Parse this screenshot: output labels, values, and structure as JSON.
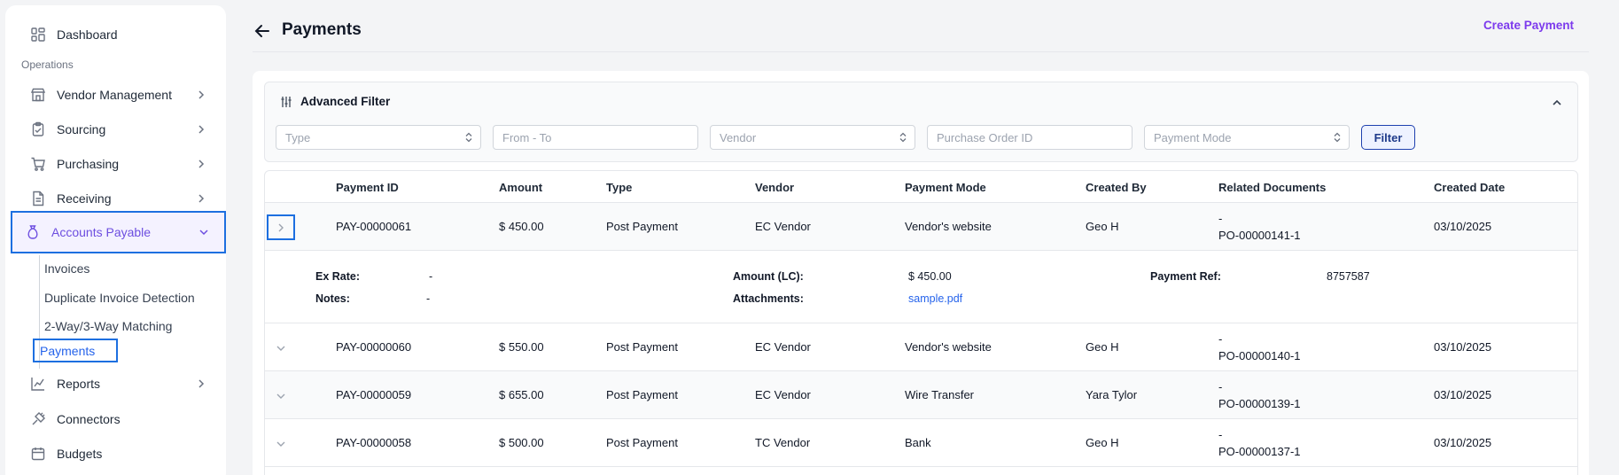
{
  "sidebar": {
    "dashboard": "Dashboard",
    "section_label": "Operations",
    "items": [
      {
        "label": "Vendor Management"
      },
      {
        "label": "Sourcing"
      },
      {
        "label": "Purchasing"
      },
      {
        "label": "Receiving"
      },
      {
        "label": "Accounts Payable"
      }
    ],
    "sub_items": [
      {
        "label": "Invoices"
      },
      {
        "label": "Duplicate Invoice Detection"
      },
      {
        "label": "2-Way/3-Way Matching"
      },
      {
        "label": "Payments"
      }
    ],
    "bottom_items": [
      {
        "label": "Reports"
      },
      {
        "label": "Connectors"
      },
      {
        "label": "Budgets"
      }
    ],
    "accent_color": "#6d4ee0"
  },
  "header": {
    "title": "Payments",
    "create_label": "Create Payment"
  },
  "filter": {
    "title": "Advanced Filter",
    "type_placeholder": "Type",
    "date_placeholder": "From - To",
    "vendor_placeholder": "Vendor",
    "po_placeholder": "Purchase Order ID",
    "mode_placeholder": "Payment Mode",
    "button_label": "Filter"
  },
  "table": {
    "columns": [
      "Payment ID",
      "Amount",
      "Type",
      "Vendor",
      "Payment Mode",
      "Created By",
      "Related Documents",
      "Created Date"
    ],
    "rows": [
      {
        "id": "PAY-00000061",
        "amount": "$ 450.00",
        "type": "Post Payment",
        "vendor": "EC Vendor",
        "mode": "Vendor's website",
        "created_by": "Geo H",
        "doc_line1": "-",
        "doc_line2": "PO-00000141-1",
        "date": "03/10/2025"
      },
      {
        "id": "PAY-00000060",
        "amount": "$ 550.00",
        "type": "Post Payment",
        "vendor": "EC Vendor",
        "mode": "Vendor's website",
        "created_by": "Geo H",
        "doc_line1": "-",
        "doc_line2": "PO-00000140-1",
        "date": "03/10/2025"
      },
      {
        "id": "PAY-00000059",
        "amount": "$ 655.00",
        "type": "Post Payment",
        "vendor": "EC Vendor",
        "mode": "Wire Transfer",
        "created_by": "Yara Tylor",
        "doc_line1": "-",
        "doc_line2": "PO-00000139-1",
        "date": "03/10/2025"
      },
      {
        "id": "PAY-00000058",
        "amount": "$ 500.00",
        "type": "Post Payment",
        "vendor": "TC Vendor",
        "mode": "Bank",
        "created_by": "Geo H",
        "doc_line1": "-",
        "doc_line2": "PO-00000137-1",
        "date": "03/10/2025"
      }
    ],
    "detail": {
      "ex_rate_label": "Ex Rate:",
      "ex_rate_value": "-",
      "notes_label": "Notes:",
      "notes_value": "-",
      "amount_lc_label": "Amount (LC):",
      "amount_lc_value": "$ 450.00",
      "attachments_label": "Attachments:",
      "attachments_value": "sample.pdf",
      "payment_ref_label": "Payment Ref:",
      "payment_ref_value": "8757587"
    }
  }
}
